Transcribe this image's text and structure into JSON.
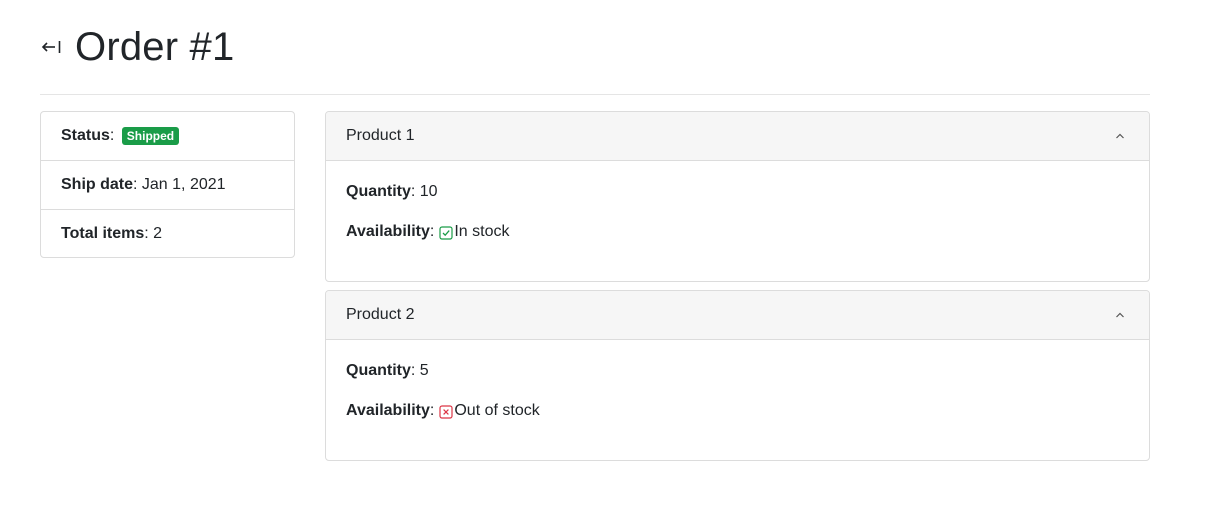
{
  "header": {
    "title": "Order #1",
    "back_icon": "back-arrow-icon"
  },
  "summary": {
    "status_label": "Status",
    "status_value": "Shipped",
    "status_color": "#1a9c48",
    "ship_date_label": "Ship date",
    "ship_date_value": "Jan 1, 2021",
    "total_items_label": "Total items",
    "total_items_value": "2"
  },
  "products": [
    {
      "name": "Product 1",
      "quantity_label": "Quantity",
      "quantity_value": "10",
      "availability_label": "Availability",
      "availability_value": "In stock",
      "availability_icon": "check-square-icon",
      "availability_color": "#1a9c48",
      "chevron_icon": "chevron-up-icon"
    },
    {
      "name": "Product 2",
      "quantity_label": "Quantity",
      "quantity_value": "5",
      "availability_label": "Availability",
      "availability_value": "Out of stock",
      "availability_icon": "x-square-icon",
      "availability_color": "#dc3545",
      "chevron_icon": "chevron-up-icon"
    }
  ]
}
